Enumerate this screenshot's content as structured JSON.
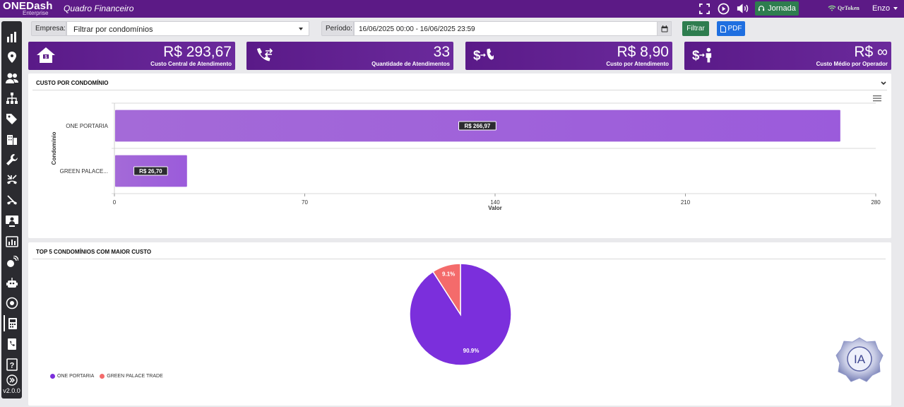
{
  "header": {
    "brand_main": "ONEDash",
    "brand_sub": "Enterprise",
    "page_title": "Quadro Financeiro",
    "jornada_label": "Jornada",
    "qrtoken_label": "QrToken",
    "user_name": "Enzo"
  },
  "sidebar": {
    "items": [
      "dashboard-icon",
      "map-pin-icon",
      "users-icon",
      "org-chart-icon",
      "tags-icon",
      "building-icon",
      "wrench-icon",
      "phone-transfer-icon",
      "phone-missed-icon",
      "monitor-user-icon",
      "bar-chart-icon",
      "satellite-icon",
      "robot-icon",
      "disc-icon",
      "calculator-icon",
      "phone-book-icon",
      "help-icon",
      "expand-icon"
    ],
    "version": "v2.0.0"
  },
  "filters": {
    "empresa_label": "Empresa:",
    "empresa_value": "Filtrar por condomínios",
    "periodo_label": "Período:",
    "periodo_value": "16/06/2025 00:00 - 16/06/2025 23:59",
    "filtrar_label": "Filtrar",
    "pdf_label": "PDF"
  },
  "kpis": [
    {
      "value": "R$ 293,67",
      "label": "Custo Central de Atendimento",
      "icon": "home-icon"
    },
    {
      "value": "33",
      "label": "Quantidade de Atendimentos",
      "icon": "phone-transfer-icon"
    },
    {
      "value": "R$ 8,90",
      "label": "Custo por Atendimento",
      "icon": "money-phone-icon"
    },
    {
      "value": "R$ ∞",
      "label": "Custo Médio por Operador",
      "icon": "money-person-icon"
    }
  ],
  "bar_panel": {
    "title": "CUSTO POR CONDOMÍNIO"
  },
  "pie_panel": {
    "title": "TOP 5 CONDOMÍNIOS COM MAIOR CUSTO"
  },
  "colors": {
    "brand": "#5c1a86",
    "bar": "#9b5bdb",
    "pie_a": "#7b2fdc",
    "pie_b": "#f46b6b",
    "green": "#2e7d4f",
    "blue": "#1f6fe0"
  },
  "chart_data": [
    {
      "type": "bar",
      "orientation": "horizontal",
      "categories": [
        "ONE PORTARIA",
        "GREEN PALACE..."
      ],
      "values": [
        266.97,
        26.7
      ],
      "data_labels": [
        "R$ 266,97",
        "R$ 26,70"
      ],
      "xlabel": "Valor",
      "ylabel": "Condomínio",
      "xlim": [
        0,
        280
      ],
      "xticks": [
        0,
        70,
        140,
        210,
        280
      ],
      "grid": true
    },
    {
      "type": "pie",
      "categories": [
        "ONE PORTARIA",
        "GREEN PALACE TRADE"
      ],
      "values": [
        90.9,
        9.1
      ],
      "data_labels": [
        "90.9%",
        "9.1%"
      ],
      "legend": "bottom-left"
    }
  ]
}
